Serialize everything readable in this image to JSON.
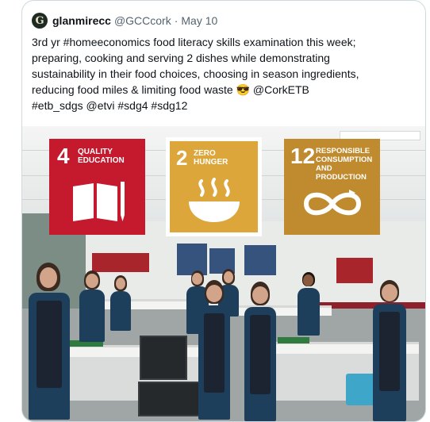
{
  "tweet": {
    "author_name": "glanmirecc",
    "author_handle": "@GCCcork",
    "separator": "·",
    "date": "May 10",
    "avatar_letter": "G",
    "text": "3rd yr #homeeconomics food literacy skills examination this week;\npreparing, cooking and serving 2 dishes while demonstrating\nsustainability in their food choices, choosing in season ingredients,\nreducing food miles & limiting food waste 😎 @CorkETB\n#etb_sdgs @etvi #sdg4 #sdg12"
  },
  "media": {
    "sdg_tiles": [
      {
        "number": "4",
        "title_line1": "QUALITY",
        "title_line2": "EDUCATION",
        "title_line3": "",
        "color": "#c5192d",
        "icon": "book-pencil-icon"
      },
      {
        "number": "2",
        "title_line1": "ZERO",
        "title_line2": "HUNGER",
        "title_line3": "",
        "color": "#dda63a",
        "icon": "steaming-bowl-icon"
      },
      {
        "number": "12",
        "title_line1": "RESPONSIBLE",
        "title_line2": "CONSUMPTION",
        "title_line3": "AND PRODUCTION",
        "color": "#bf8b2e",
        "icon": "infinity-loop-icon"
      }
    ]
  }
}
